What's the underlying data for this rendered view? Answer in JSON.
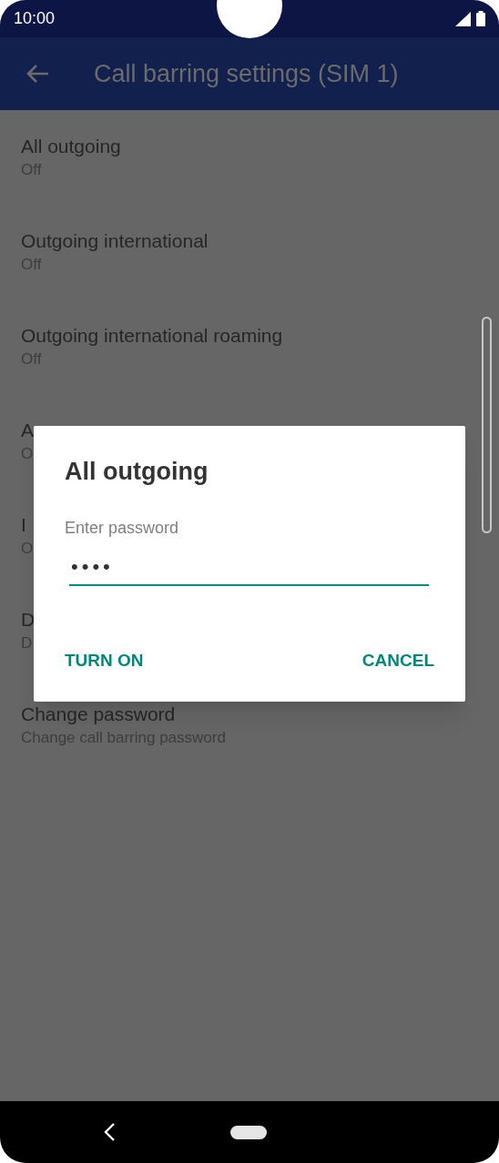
{
  "status_bar": {
    "time": "10:00"
  },
  "app_bar": {
    "title": "Call barring settings (SIM 1)"
  },
  "settings": [
    {
      "title": "All outgoing",
      "summary": "Off"
    },
    {
      "title": "Outgoing international",
      "summary": "Off"
    },
    {
      "title": "Outgoing international roaming",
      "summary": "Off"
    },
    {
      "title": "A",
      "summary": "O"
    },
    {
      "title": "I",
      "summary": "O"
    },
    {
      "title": "D",
      "summary": "D"
    },
    {
      "title": "Change password",
      "summary": "Change call barring password"
    }
  ],
  "dialog": {
    "title": "All outgoing",
    "field": {
      "label": "Enter password",
      "value": "••••",
      "focused": true
    },
    "buttons": [
      "TURN ON",
      "CANCEL"
    ]
  }
}
